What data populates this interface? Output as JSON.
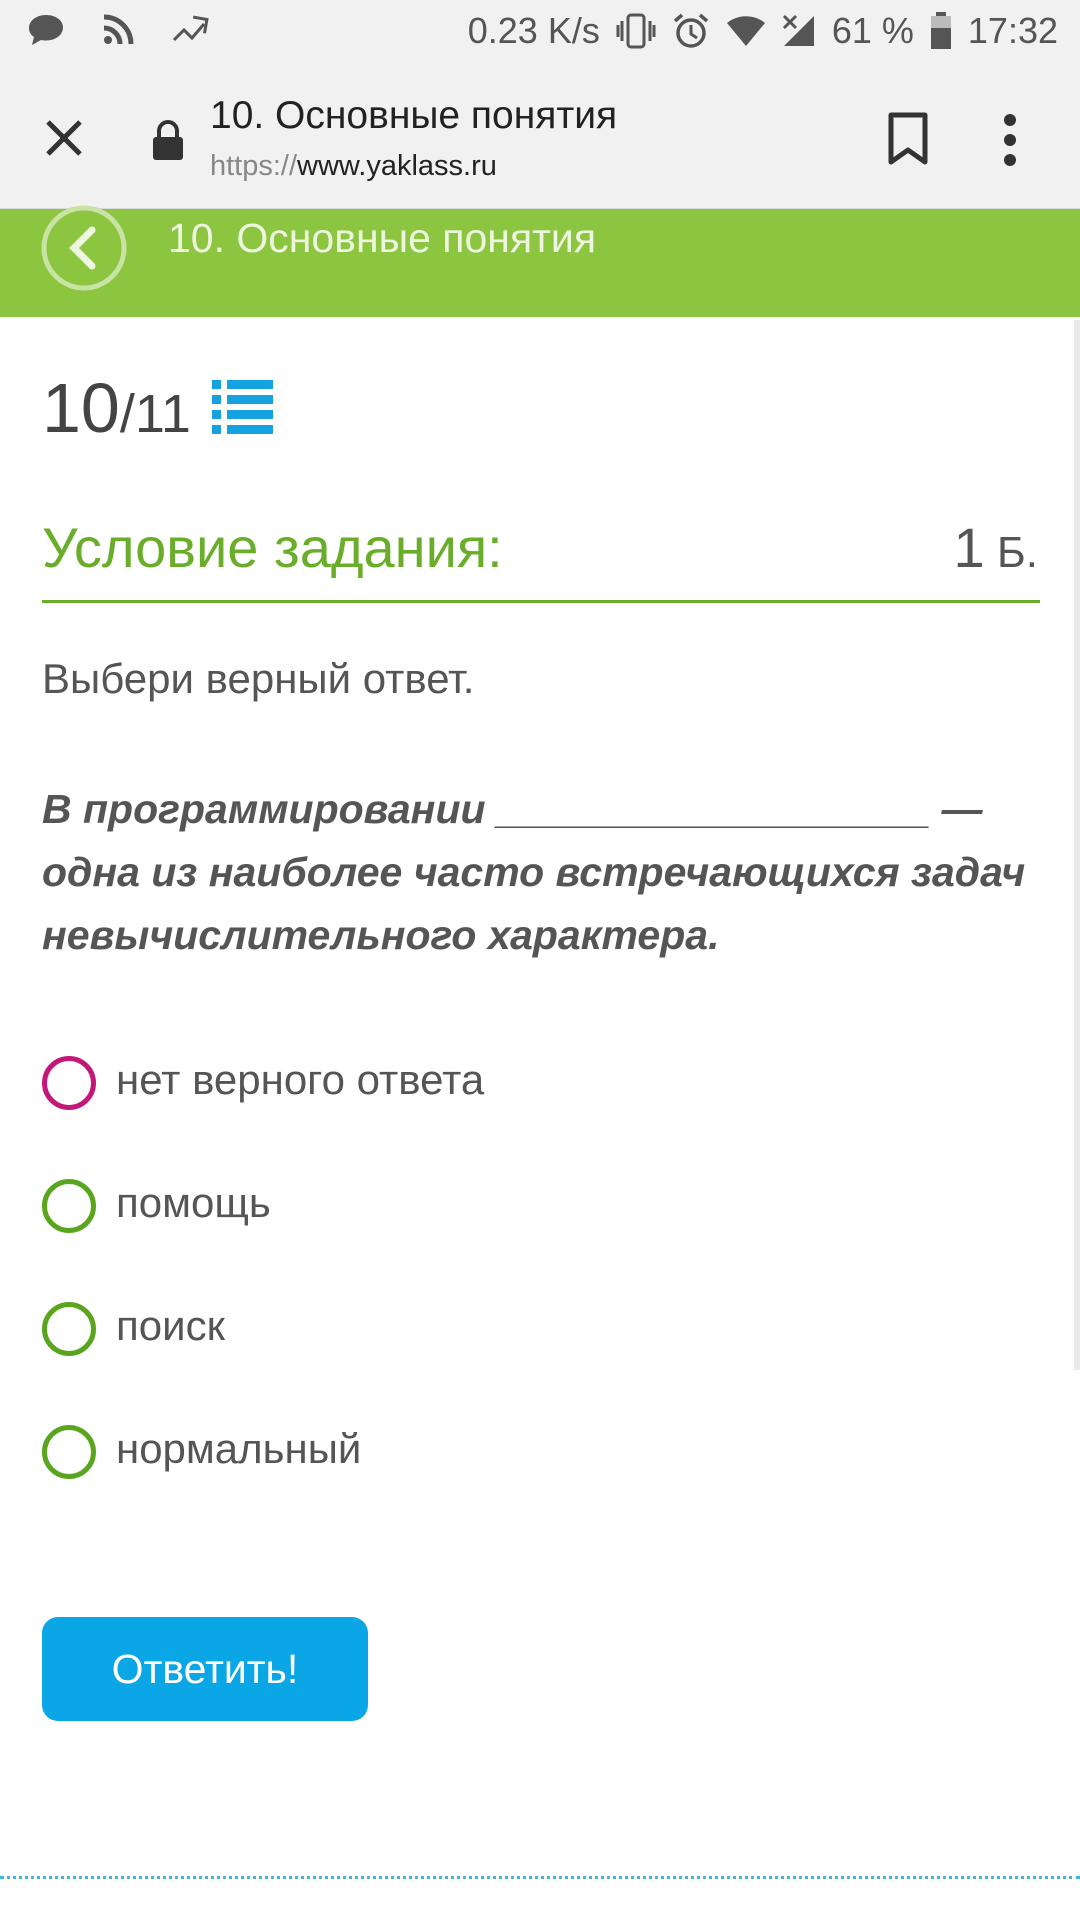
{
  "status_bar": {
    "net_speed": "0.23 K/s",
    "battery_percent": "61 %",
    "time": "17:32",
    "icons": [
      "chat-icon",
      "rss-icon",
      "missed-call-icon",
      "vibrate-icon",
      "alarm-icon",
      "wifi-icon",
      "signal-icon",
      "battery-icon"
    ]
  },
  "browser": {
    "page_title": "10. Основные понятия",
    "url_scheme": "https://",
    "url_host": "www.yaklass.ru"
  },
  "header": {
    "title": "10. Основные понятия",
    "color": "#8cc641"
  },
  "task": {
    "current": "10",
    "total": "/11",
    "condition_label": "Условие задания:",
    "points_value": "1",
    "points_unit": " Б.",
    "prompt": "Выбери верный ответ.",
    "question": "В программировании ___________________ — одна из наиболее часто встречающихся задач невычислительного характера."
  },
  "options": [
    {
      "label": "нет верного ответа",
      "ring_color": "#c2187a"
    },
    {
      "label": "помощь",
      "ring_color": "#5aa51e"
    },
    {
      "label": "поиск",
      "ring_color": "#5aa51e"
    },
    {
      "label": "нормальный",
      "ring_color": "#5aa51e"
    }
  ],
  "submit_label": "Ответить!",
  "colors": {
    "accent_green": "#6aad2a",
    "button_blue": "#0aa6e6"
  }
}
